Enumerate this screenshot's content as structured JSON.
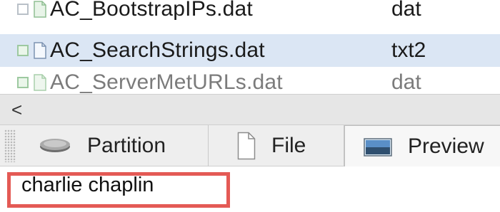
{
  "file_list": {
    "rows": [
      {
        "name": "AC_BootstrapIPs.dat",
        "type": "dat"
      },
      {
        "name": "AC_SearchStrings.dat",
        "type": "txt2"
      },
      {
        "name": "AC_ServerMetURLs.dat",
        "type": "dat"
      }
    ],
    "selected_index": 1
  },
  "scrollbar": {
    "left_arrow": "<"
  },
  "tabs": [
    {
      "label": "Partition",
      "icon": "drive-icon"
    },
    {
      "label": "File",
      "icon": "document-icon"
    },
    {
      "label": "Preview",
      "icon": "image-icon"
    }
  ],
  "active_tab": "Preview",
  "preview": {
    "text": "charlie chaplin",
    "highlight_color": "#e45a55"
  }
}
